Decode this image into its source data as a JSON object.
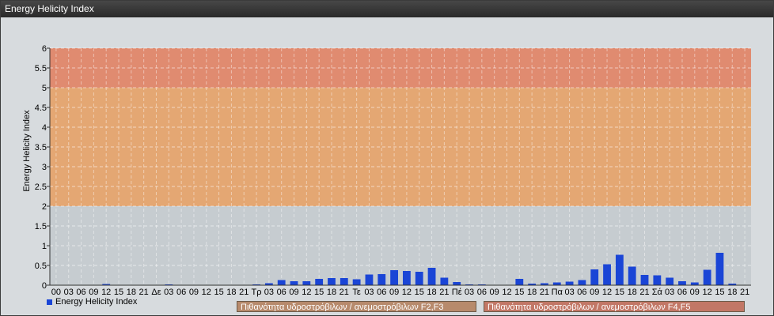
{
  "window": {
    "title": "Energy Helicity Index"
  },
  "chart_data": {
    "type": "bar",
    "title": "",
    "xlabel": "",
    "ylabel": "Energy Helicity Index",
    "ylim": [
      0,
      6
    ],
    "yticks": [
      "0",
      "0.5",
      "1",
      "1.5",
      "2",
      "2.5",
      "3",
      "3.5",
      "4",
      "4.5",
      "5",
      "5.5",
      "6"
    ],
    "grid": true,
    "categories": [
      "00",
      "03",
      "06",
      "09",
      "12",
      "15",
      "18",
      "21",
      "Δε",
      "03",
      "06",
      "09",
      "12",
      "15",
      "18",
      "21",
      "Τρ",
      "03",
      "06",
      "09",
      "12",
      "15",
      "18",
      "21",
      "Τε",
      "03",
      "06",
      "09",
      "12",
      "15",
      "18",
      "21",
      "Πέ",
      "03",
      "06",
      "09",
      "12",
      "15",
      "18",
      "21",
      "Πα",
      "03",
      "06",
      "09",
      "12",
      "15",
      "18",
      "21",
      "Σά",
      "03",
      "06",
      "09",
      "12",
      "15",
      "18",
      "21"
    ],
    "series": [
      {
        "name": "Energy Helicity Index",
        "color": "#1a45d6",
        "values": [
          0.01,
          0.01,
          0.01,
          0.01,
          0.03,
          0.01,
          0.01,
          0.01,
          0.01,
          0.02,
          0.01,
          0.01,
          0.01,
          0.01,
          0.01,
          0.01,
          0.02,
          0.05,
          0.13,
          0.1,
          0.1,
          0.16,
          0.18,
          0.18,
          0.15,
          0.27,
          0.28,
          0.38,
          0.36,
          0.34,
          0.44,
          0.19,
          0.08,
          0.02,
          0.02,
          0.01,
          0.01,
          0.16,
          0.04,
          0.05,
          0.07,
          0.09,
          0.13,
          0.4,
          0.53,
          0.77,
          0.47,
          0.26,
          0.25,
          0.19,
          0.1,
          0.07,
          0.39,
          0.82,
          0.04,
          0.01
        ]
      }
    ],
    "bands": [
      {
        "from": 0,
        "to": 2,
        "color": "#c6ccd0"
      },
      {
        "from": 2,
        "to": 5,
        "color": "#e4a773",
        "label": "Πιθανότητα υδροστρόβιλων / ανεμοστρόβιλων F2,F3"
      },
      {
        "from": 5,
        "to": 6,
        "color": "#e08b70",
        "label": "Πιθανότητα υδροστρόβιλων / ανεμοστρόβιλων F4,F5"
      }
    ],
    "legend": {
      "placement": "bottom-left",
      "label": "Energy Helicity Index"
    }
  }
}
